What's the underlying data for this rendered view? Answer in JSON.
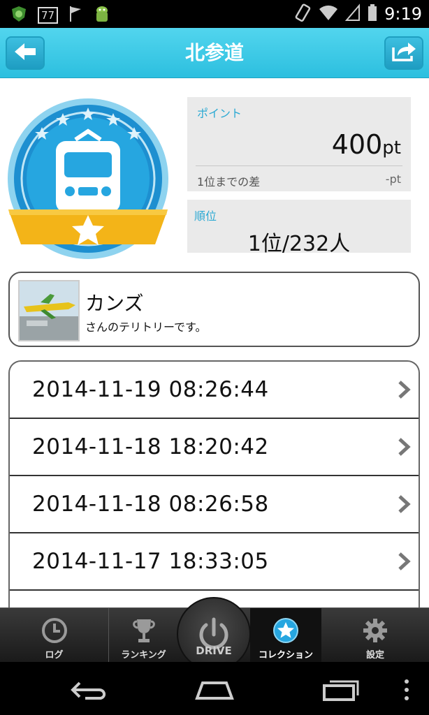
{
  "status_bar": {
    "time": "9:19",
    "badge_text": "77"
  },
  "header": {
    "title": "北参道",
    "back_icon": "arrow-left-icon",
    "share_icon": "share-icon"
  },
  "points": {
    "label": "ポイント",
    "value": "400",
    "unit": "pt",
    "diff_label": "1位までの差",
    "diff_value": "-pt"
  },
  "rank": {
    "label": "順位",
    "value": "1位/232人"
  },
  "owner": {
    "name": "カンズ",
    "subtitle": "さんのテリトリーです。"
  },
  "history": [
    "2014-11-19 08:26:44",
    "2014-11-18 18:20:42",
    "2014-11-18 08:26:58",
    "2014-11-17 18:33:05"
  ],
  "bottom_nav": {
    "log": "ログ",
    "ranking": "ランキング",
    "drive": "DRIVE",
    "collection": "コレクション",
    "settings": "設定",
    "active": "collection"
  },
  "colors": {
    "header": "#3ccbe8",
    "accent": "#2ba9d3",
    "medal_ribbon": "#f3b418"
  }
}
